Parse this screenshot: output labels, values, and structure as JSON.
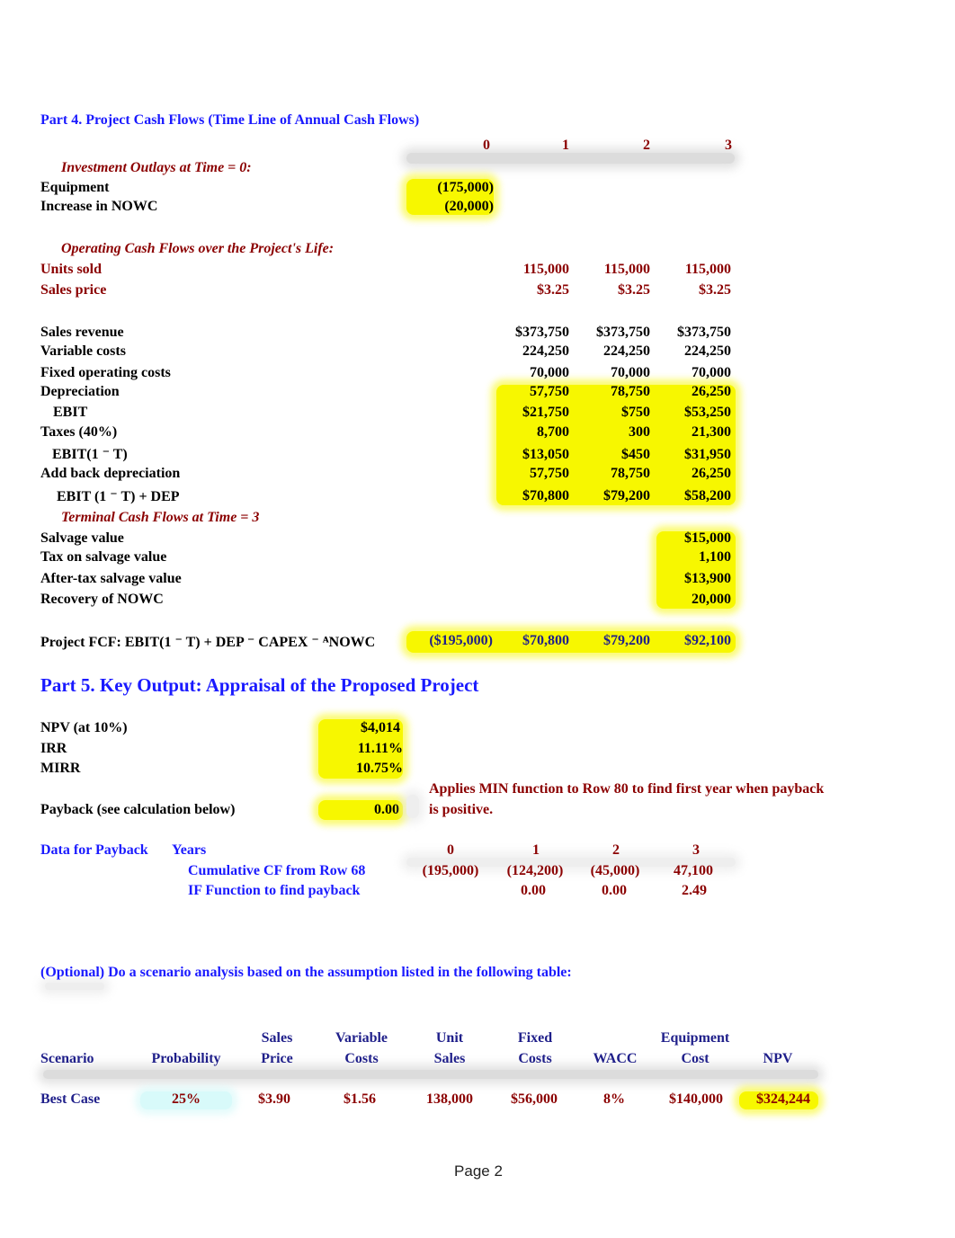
{
  "part4": {
    "title": "Part 4.  Project Cash Flows (Time Line of Annual Cash Flows)",
    "years": [
      "0",
      "1",
      "2",
      "3"
    ],
    "investment_header": "Investment Outlays at Time = 0:",
    "investment": [
      {
        "label": "Equipment",
        "value": "(175,000)"
      },
      {
        "label": "Increase in NOWC",
        "value": "(20,000)"
      }
    ],
    "operating_header": "Operating Cash Flows over the Project's Life:",
    "inputs": [
      {
        "label": "Units sold",
        "values": [
          "115,000",
          "115,000",
          "115,000"
        ]
      },
      {
        "label": "Sales price",
        "values": [
          "$3.25",
          "$3.25",
          "$3.25"
        ]
      }
    ],
    "operating": [
      {
        "label": "Sales revenue",
        "values": [
          "$373,750",
          "$373,750",
          "$373,750"
        ]
      },
      {
        "label": "Variable costs",
        "values": [
          "224,250",
          "224,250",
          "224,250"
        ]
      },
      {
        "label": "Fixed operating costs",
        "values": [
          "70,000",
          "70,000",
          "70,000"
        ]
      },
      {
        "label": "Depreciation",
        "values": [
          "57,750",
          "78,750",
          "26,250"
        ]
      },
      {
        "label": "EBIT",
        "values": [
          "$21,750",
          "$750",
          "$53,250"
        ]
      },
      {
        "label": "Taxes (40%)",
        "values": [
          "8,700",
          "300",
          "21,300"
        ]
      },
      {
        "label": "EBIT(1 ⁻ T)",
        "values": [
          "$13,050",
          "$450",
          "$31,950"
        ]
      },
      {
        "label": "Add back depreciation",
        "values": [
          "57,750",
          "78,750",
          "26,250"
        ]
      },
      {
        "label": "EBIT (1 ⁻ T) + DEP",
        "values": [
          "$70,800",
          "$79,200",
          "$58,200"
        ]
      }
    ],
    "terminal_header": "Terminal Cash Flows at Time = 3",
    "terminal": [
      {
        "label": "Salvage value",
        "value": "$15,000"
      },
      {
        "label": "Tax on salvage value",
        "value": "1,100"
      },
      {
        "label": "After-tax salvage value",
        "value": "$13,900"
      },
      {
        "label": "Recovery of NOWC",
        "value": "20,000"
      }
    ],
    "fcf": {
      "label": "Project FCF: EBIT(1 ⁻ T) + DEP ⁻ CAPEX ⁻ ᴬNOWC",
      "values": [
        "($195,000)",
        "$70,800",
        "$79,200",
        "$92,100"
      ]
    }
  },
  "part5": {
    "title": "Part 5.  Key Output:  Appraisal of the Proposed Project",
    "metrics": [
      {
        "label": "NPV (at 10%)",
        "value": "$4,014"
      },
      {
        "label": "IRR",
        "value": "11.11%"
      },
      {
        "label": "MIRR",
        "value": "10.75%"
      }
    ],
    "payback": {
      "label": "Payback (see calculation below)",
      "value": "0.00"
    },
    "note_line1": "Applies MIN function to Row 80 to find first year when payback",
    "note_line2": "is positive."
  },
  "payback_data": {
    "title": "Data for Payback",
    "years_label": "Years",
    "years": [
      "0",
      "1",
      "2",
      "3"
    ],
    "cumulative_label": "Cumulative CF from Row 68",
    "cumulative": [
      "(195,000)",
      "(124,200)",
      "(45,000)",
      "47,100"
    ],
    "if_label": "IF Function to find payback",
    "if_values": [
      "",
      "0.00",
      "0.00",
      "2.49"
    ]
  },
  "scenario": {
    "title": "(Optional) Do a scenario analysis based on the assumption listed in the following table:",
    "headers": [
      {
        "line1": "",
        "line2": "Scenario"
      },
      {
        "line1": "",
        "line2": "Probability"
      },
      {
        "line1": "Sales",
        "line2": "Price"
      },
      {
        "line1": "Variable",
        "line2": "Costs"
      },
      {
        "line1": "Unit",
        "line2": "Sales"
      },
      {
        "line1": "Fixed",
        "line2": "Costs"
      },
      {
        "line1": "",
        "line2": "WACC"
      },
      {
        "line1": "Equipment",
        "line2": "Cost"
      },
      {
        "line1": "",
        "line2": "NPV"
      }
    ],
    "rows": [
      {
        "scenario": "Best Case",
        "probability": "25%",
        "sales_price": "$3.90",
        "variable_costs": "$1.56",
        "unit_sales": "138,000",
        "fixed_costs": "$56,000",
        "wacc": "8%",
        "equipment_cost": "$140,000",
        "npv": "$324,244"
      }
    ]
  },
  "footer": {
    "page": "Page 2"
  }
}
